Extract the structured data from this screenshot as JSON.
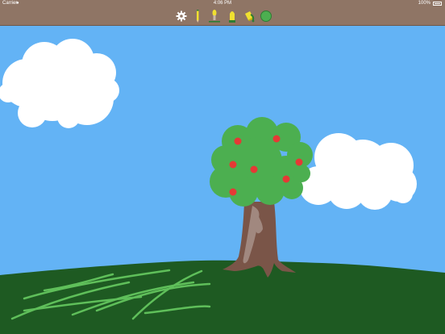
{
  "status": {
    "carrier": "Carrier",
    "time": "4:06 PM",
    "battery": "100%"
  },
  "toolbar": {
    "tools": [
      {
        "name": "settings",
        "icon": "gear-icon"
      },
      {
        "name": "pencil",
        "icon": "pencil-icon"
      },
      {
        "name": "brush",
        "icon": "brush-icon"
      },
      {
        "name": "marker",
        "icon": "marker-icon"
      },
      {
        "name": "fill",
        "icon": "paint-bucket-icon"
      },
      {
        "name": "color",
        "icon": "color-swatch-icon"
      }
    ]
  },
  "colors": {
    "toolbar": "#8f7565",
    "sky": "#63b3f5",
    "grass": "#1e5a22",
    "grass_strokes": "#5fbf5a",
    "foliage": "#4caf50",
    "apple": "#e53935",
    "trunk": "#7a5548",
    "trunk_highlight": "#a1887f",
    "cloud": "#ffffff",
    "selected_color": "#4caf50"
  },
  "drawing": {
    "subject": "tree with apples, clouds and grass"
  }
}
